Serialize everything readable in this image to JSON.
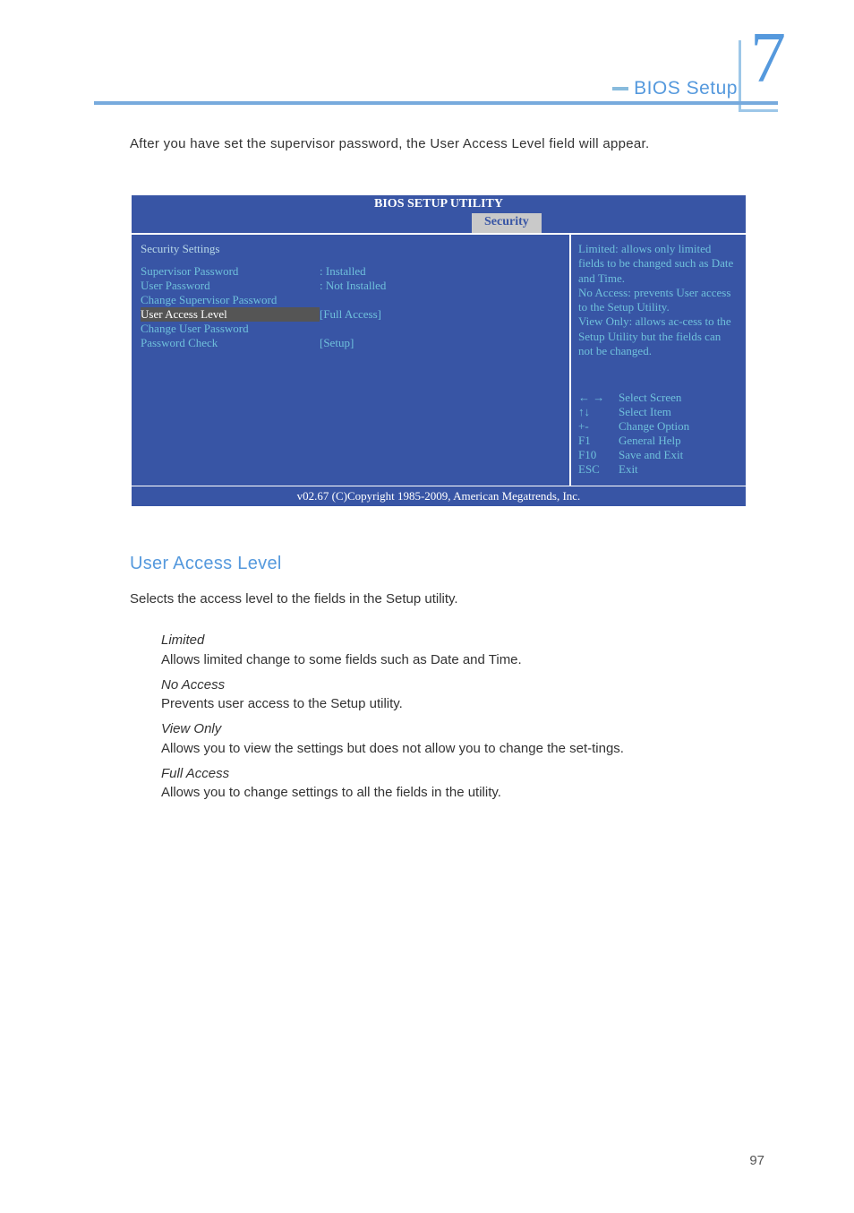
{
  "chapter": {
    "label": "BIOS Setup",
    "number": "7"
  },
  "intro_text": "After you have set the supervisor password, the User Access Level field will appear.",
  "bios": {
    "title": "BIOS SETUP UTILITY",
    "tab": "Security",
    "heading": "Security Settings",
    "rows": [
      {
        "label": "Supervisor Password",
        "value": ":  Installed",
        "hl": false
      },
      {
        "label": "User Password",
        "value": ":  Not Installed",
        "hl": false
      },
      {
        "label": "",
        "value": "",
        "hl": false
      },
      {
        "label": "Change Supervisor Password",
        "value": "",
        "hl": false
      },
      {
        "label": "User Access Level",
        "value": "[Full Access]",
        "hl": true
      },
      {
        "label": "Change User Password",
        "value": "",
        "hl": false
      },
      {
        "label": "Password Check",
        "value": "[Setup]",
        "hl": false
      }
    ],
    "help_text": "Limited: allows only limited fields to be changed such as Date and Time.\nNo Access: prevents User access to the Setup Utility.\nView Only: allows ac-cess to the Setup Utility but the fields can not be changed.",
    "keys": [
      {
        "k": "← →",
        "d": "Select Screen"
      },
      {
        "k": "↑↓",
        "d": "Select Item"
      },
      {
        "k": "+-",
        "d": "Change Option"
      },
      {
        "k": "F1",
        "d": "General Help"
      },
      {
        "k": "F10",
        "d": "Save and Exit"
      },
      {
        "k": "ESC",
        "d": "Exit"
      }
    ],
    "footer": "v02.67 (C)Copyright 1985-2009, American Megatrends, Inc."
  },
  "section": {
    "title": "User Access Level",
    "intro": "Selects the access level to the fields in the Setup utility.",
    "items": [
      {
        "term": "Limited",
        "desc": "Allows limited change to some fields such as Date and Time."
      },
      {
        "term": "No Access",
        "desc": "Prevents user access to the Setup utility."
      },
      {
        "term": "View Only",
        "desc": "Allows you to view the settings but does not allow you to change the set-tings."
      },
      {
        "term": "Full Access",
        "desc": "Allows you to change settings to all the fields in the utility."
      }
    ]
  },
  "page_number": "97"
}
